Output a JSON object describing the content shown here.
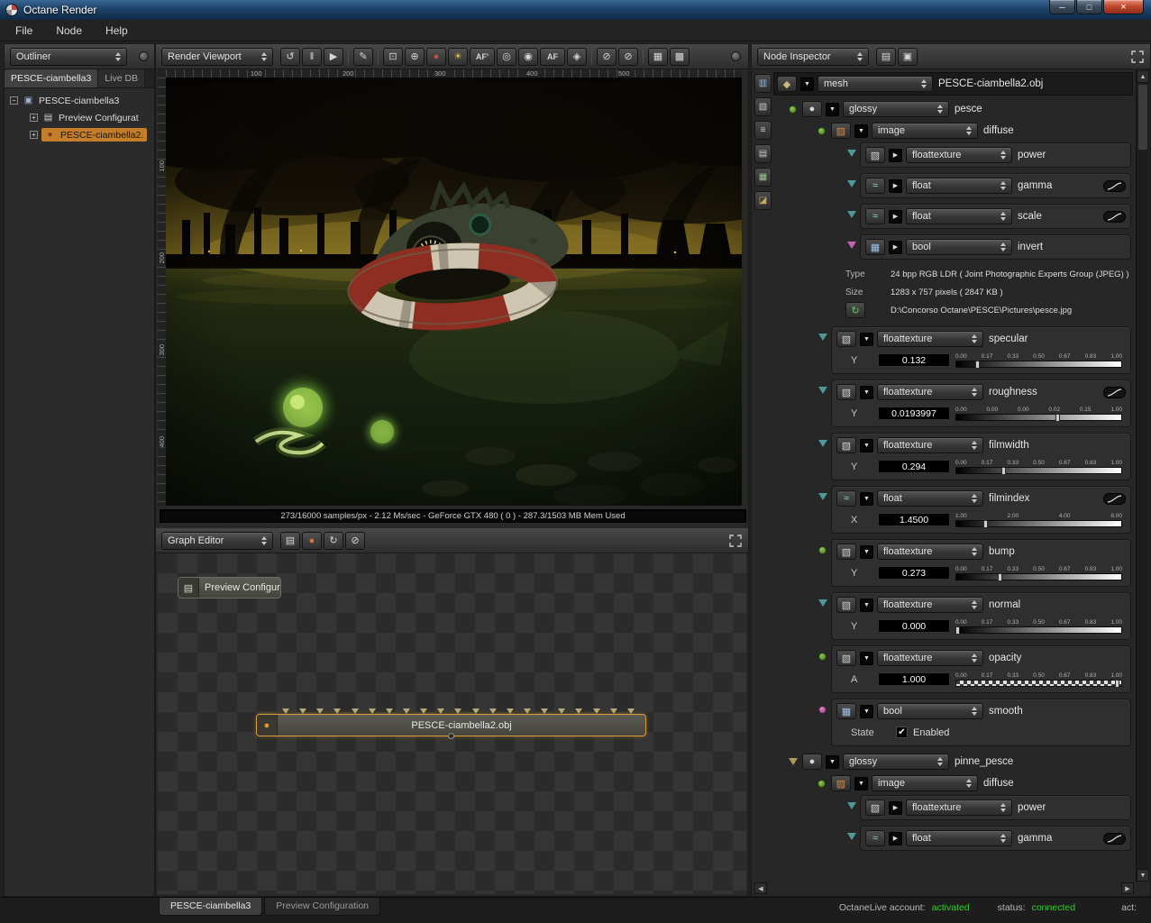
{
  "window": {
    "title": "Octane Render",
    "menu": [
      "File",
      "Node",
      "Help"
    ]
  },
  "colors": {
    "accent_orange": "#c47e2a",
    "status_green": "#33cc33",
    "node_selected_border": "#d89b3c"
  },
  "outliner": {
    "selector": "Outliner",
    "tabs": [
      "PESCE-ciambella3",
      "Live DB"
    ],
    "tree": [
      {
        "label": "PESCE-ciambella3"
      },
      {
        "label": "Preview Configurat"
      },
      {
        "label": "PESCE-ciambella2."
      }
    ]
  },
  "viewport": {
    "selector": "Render Viewport",
    "status": "273/16000 samples/px - 2.12 Ms/sec - GeForce GTX 480 ( 0 ) - 287.3/1503 MB Mem Used",
    "ruler_top": [
      "100",
      "200",
      "300",
      "400",
      "500"
    ],
    "ruler_left": [
      "100",
      "200",
      "300",
      "400"
    ],
    "toolbar": [
      {
        "name": "restart-render-button",
        "glyph": "↺"
      },
      {
        "name": "pause-render-button",
        "glyph": "‖"
      },
      {
        "name": "start-render-button",
        "glyph": "▶"
      },
      {
        "name": "separator"
      },
      {
        "name": "paint-mode-button",
        "glyph": "✎"
      },
      {
        "name": "separator"
      },
      {
        "name": "region-render-button",
        "glyph": "⊡"
      },
      {
        "name": "material-picker-button",
        "glyph": "⊕"
      },
      {
        "name": "render-ball-button",
        "glyph": "●",
        "color": "#c05040"
      },
      {
        "name": "firefly-removal-button",
        "glyph": "☀",
        "color": "#e0c24a"
      },
      {
        "name": "autofocus-aperture-button",
        "text": "AF'"
      },
      {
        "name": "lens-button",
        "glyph": "◎"
      },
      {
        "name": "white-balance-button",
        "glyph": "◉"
      },
      {
        "name": "autofocus-button",
        "text": "AF"
      },
      {
        "name": "camera-lock-button",
        "glyph": "◈"
      },
      {
        "name": "separator"
      },
      {
        "name": "disable-kernel-button",
        "glyph": "⊘"
      },
      {
        "name": "disable-imager-button",
        "glyph": "⊘"
      },
      {
        "name": "separator"
      },
      {
        "name": "film-grid-button",
        "glyph": "▦"
      },
      {
        "name": "alpha-checker-button",
        "glyph": "▩"
      }
    ]
  },
  "graph": {
    "selector": "Graph Editor",
    "toolbar": [
      {
        "name": "add-node-button",
        "glyph": "▤"
      },
      {
        "name": "material-ball-button",
        "glyph": "●",
        "color": "#c87848"
      },
      {
        "name": "re-render-button",
        "glyph": "↻"
      },
      {
        "name": "delete-node-button",
        "glyph": "⊘"
      }
    ],
    "nodes": {
      "preview": "Preview Configuration",
      "mesh": "PESCE-ciambella2.obj"
    },
    "tabs": [
      "PESCE-ciambella3",
      "Preview Configuration"
    ]
  },
  "inspector": {
    "selector": "Node Inspector",
    "header_buttons": [
      {
        "name": "collapse-all-button",
        "glyph": "▤"
      },
      {
        "name": "pin-panel-button",
        "glyph": "▣"
      }
    ],
    "side_strip": [
      {
        "name": "save-image-icon",
        "glyph": "▥",
        "color": "#8fb8e8"
      },
      {
        "name": "render-passes-icon",
        "glyph": "▧",
        "color": "#cccccc"
      },
      {
        "name": "layers-icon",
        "glyph": "≡",
        "color": "#cccccc"
      },
      {
        "name": "notes-icon",
        "glyph": "▤",
        "color": "#cccccc"
      },
      {
        "name": "texture-preview-icon",
        "glyph": "▦",
        "color": "#9ec88e"
      },
      {
        "name": "environment-icon",
        "glyph": "◪",
        "color": "#c8a860"
      }
    ],
    "groups": [
      {
        "kind": "root",
        "type": "mesh",
        "label": "PESCE-ciambella2.obj",
        "icon": "mesh",
        "indent": 0
      },
      {
        "kind": "node",
        "type": "glossy",
        "label": "pesce",
        "icon": "sphere",
        "pin": "c-green",
        "indent": 1
      },
      {
        "kind": "node",
        "type": "image",
        "label": "diffuse",
        "icon": "image",
        "pin": "c-green",
        "indent": 2
      },
      {
        "kind": "sub",
        "type": "floattexture",
        "label": "power",
        "icon": "floattex",
        "pin": "t-teal",
        "indent": 3
      },
      {
        "kind": "sub",
        "type": "float",
        "label": "gamma",
        "icon": "float",
        "pin": "t-teal",
        "indent": 3,
        "curve": true
      },
      {
        "kind": "sub",
        "type": "float",
        "label": "scale",
        "icon": "float",
        "pin": "t-teal",
        "indent": 3,
        "curve": true
      },
      {
        "kind": "sub",
        "type": "bool",
        "label": "invert",
        "icon": "bool",
        "pin": "t-pink",
        "indent": 3
      },
      {
        "kind": "info",
        "indent": 3,
        "rows": [
          {
            "label": "Type",
            "value": "24 bpp RGB LDR ( Joint Photographic Experts Group (JPEG) )"
          },
          {
            "label": "Size",
            "value": "1283 x 757 pixels ( 2847 KB )"
          },
          {
            "label": "",
            "value": "D:\\Concorso Octane\\PESCE\\Pictures\\pesce.jpg",
            "icon": "reload"
          }
        ]
      },
      {
        "kind": "param",
        "type": "floattexture",
        "label": "specular",
        "icon": "floattex",
        "pin": "t-teal",
        "indent": 2,
        "channel": "Y",
        "value": "0.132",
        "ticks": [
          "0.00",
          "0.17",
          "0.33",
          "0.50",
          "0.67",
          "0.83",
          "1.00"
        ],
        "handle": 0.13,
        "slider": "gradient"
      },
      {
        "kind": "param",
        "type": "floattexture",
        "label": "roughness",
        "icon": "floattex",
        "pin": "t-teal",
        "indent": 2,
        "curve": true,
        "channel": "Y",
        "value": "0.0193997",
        "ticks": [
          "0.00",
          "0.00",
          "0.00",
          "0.02",
          "0.15",
          "1.00"
        ],
        "handle": 0.62,
        "slider": "gradient"
      },
      {
        "kind": "param",
        "type": "floattexture",
        "label": "filmwidth",
        "icon": "floattex",
        "pin": "t-teal",
        "indent": 2,
        "channel": "Y",
        "value": "0.294",
        "ticks": [
          "0.00",
          "0.17",
          "0.33",
          "0.50",
          "0.67",
          "0.83",
          "1.00"
        ],
        "handle": 0.29,
        "slider": "gradient"
      },
      {
        "kind": "param",
        "type": "float",
        "label": "filmindex",
        "icon": "float",
        "pin": "t-teal",
        "indent": 2,
        "curve": true,
        "channel": "X",
        "value": "1.4500",
        "ticks": [
          "1.00",
          "2.00",
          "4.00",
          "8.00"
        ],
        "handle": 0.18,
        "slider": "gradient"
      },
      {
        "kind": "param",
        "type": "floattexture",
        "label": "bump",
        "icon": "floattex",
        "pin": "c-green",
        "indent": 2,
        "channel": "Y",
        "value": "0.273",
        "ticks": [
          "0.00",
          "0.17",
          "0.33",
          "0.50",
          "0.67",
          "0.83",
          "1.00"
        ],
        "handle": 0.27,
        "slider": "gradient"
      },
      {
        "kind": "param",
        "type": "floattexture",
        "label": "normal",
        "icon": "floattex",
        "pin": "t-teal",
        "indent": 2,
        "channel": "Y",
        "value": "0.000",
        "ticks": [
          "0.00",
          "0.17",
          "0.33",
          "0.50",
          "0.67",
          "0.83",
          "1.00"
        ],
        "handle": 0.01,
        "slider": "gradient"
      },
      {
        "kind": "param",
        "type": "floattexture",
        "label": "opacity",
        "icon": "floattex",
        "pin": "c-green",
        "indent": 2,
        "channel": "A",
        "value": "1.000",
        "ticks": [
          "0.00",
          "0.17",
          "0.33",
          "0.50",
          "0.67",
          "0.83",
          "1.00"
        ],
        "handle": 0.98,
        "slider": "checker"
      },
      {
        "kind": "bool",
        "type": "bool",
        "label": "smooth",
        "icon": "bool",
        "pin": "c-pink",
        "indent": 2,
        "state_label": "State",
        "checkbox": "Enabled",
        "checked": true
      },
      {
        "kind": "node",
        "type": "glossy",
        "label": "pinne_pesce",
        "icon": "sphere",
        "pin": "t-tan",
        "indent": 1
      },
      {
        "kind": "node",
        "type": "image",
        "label": "diffuse",
        "icon": "image",
        "pin": "c-green",
        "indent": 2
      },
      {
        "kind": "sub",
        "type": "floattexture",
        "label": "power",
        "icon": "floattex",
        "pin": "t-teal",
        "indent": 3
      },
      {
        "kind": "sub",
        "type": "float",
        "label": "gamma",
        "icon": "float",
        "pin": "t-teal",
        "indent": 3,
        "curve": true
      }
    ]
  },
  "icons": {
    "mesh": {
      "glyph": "◆",
      "color": "#c9b97f"
    },
    "sphere": {
      "glyph": "●",
      "color": "#d8d8d8"
    },
    "image": {
      "glyph": "▨",
      "color": "#d08a4a"
    },
    "floattex": {
      "glyph": "▧",
      "color": "#d0d0d0"
    },
    "float": {
      "glyph": "≈",
      "color": "#8fd8d8"
    },
    "bool": {
      "glyph": "▦",
      "color": "#9ec2ee"
    },
    "reload": {
      "glyph": "↻",
      "color": "#5fcf58"
    },
    "config": {
      "glyph": "▤",
      "color": "#cfcfcf"
    },
    "orange_ball": {
      "glyph": "●",
      "color": "#e8952e"
    },
    "node_graph": {
      "glyph": "▣",
      "color": "#9ab0c8"
    }
  },
  "statusbar": {
    "account_label": "OctaneLive account:",
    "account_value": "activated",
    "status_label": "status:",
    "status_value": "connected",
    "act_label": "act:"
  }
}
